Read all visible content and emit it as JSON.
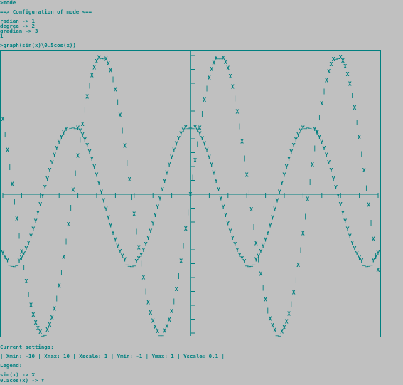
{
  "terminal": {
    "prompt_mode": ">mode",
    "config_header": "==> Configuration of mode <==",
    "options": [
      "radian -> 1",
      "degree -> 2",
      "gradian -> 3"
    ],
    "input_value": "1",
    "graph_command": ">graph(sin(x)\\0.5cos(x))",
    "settings_header": "Current settings:",
    "settings_line": "| Xmin: -10 | Xmax: 10 | Xscale: 1 | Ymin: -1 | Ymax: 1 | Yscale: 0.1 |",
    "legend_header": "Legend:",
    "legend": [
      "sin(x) -> X",
      "0.5cos(x) -> Y"
    ]
  },
  "chart_data": {
    "type": "line",
    "xlim": [
      -10,
      10
    ],
    "ylim": [
      -1,
      1
    ],
    "xscale": 1,
    "yscale": 0.1,
    "series": [
      {
        "name": "sin(x)",
        "marker": "X",
        "function": "sin"
      },
      {
        "name": "0.5cos(x)",
        "marker": "Y",
        "function": "0.5cos"
      }
    ],
    "colors": {
      "fg": "#008080",
      "bg": "#c0c0c0"
    }
  }
}
